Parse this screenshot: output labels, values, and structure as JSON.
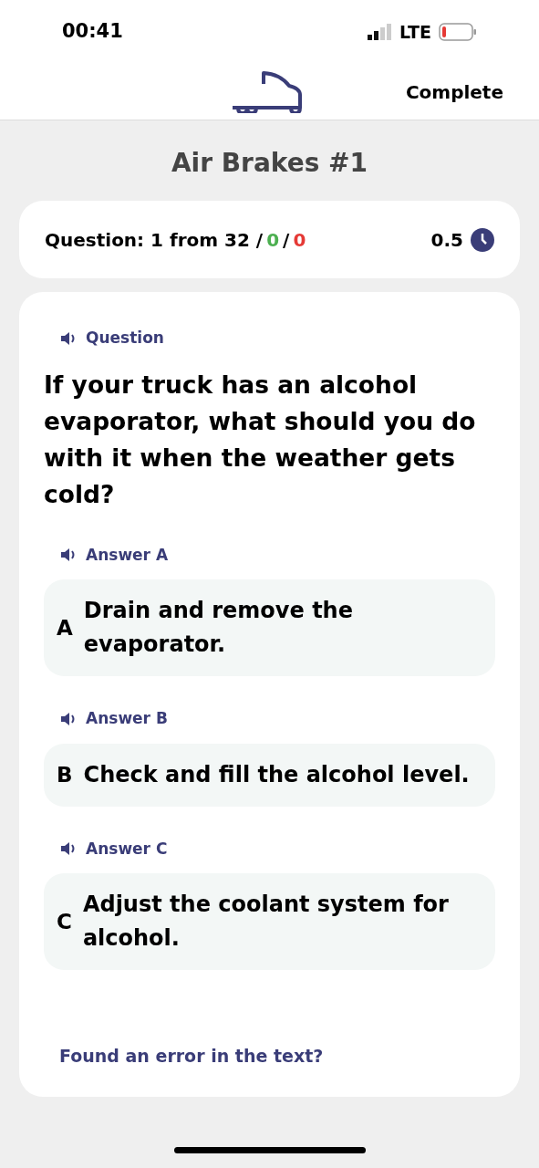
{
  "status_bar": {
    "time": "00:41",
    "network": "LTE"
  },
  "header": {
    "action": "Complete"
  },
  "title": "Air Brakes #1",
  "progress": {
    "parts": [
      {
        "text": "Question: 1 from 32 /",
        "color": "#000000"
      },
      {
        "text": "0",
        "color": "#4caf50"
      },
      {
        "text": "/",
        "color": "#000000"
      },
      {
        "text": "0",
        "color": "#e53935"
      }
    ],
    "time": "0.5"
  },
  "question": {
    "audio_label": "Question",
    "text": "If your truck has an alcohol evaporator, what should you do with it when the weather gets cold?"
  },
  "answers": [
    {
      "audio_label": "Answer A",
      "letter": "A",
      "text": "Drain and remove the evaporator."
    },
    {
      "audio_label": "Answer B",
      "letter": "B",
      "text": "Check and fill the alcohol level."
    },
    {
      "audio_label": "Answer C",
      "letter": "C",
      "text": "Adjust the coolant system for alcohol."
    }
  ],
  "report_link": "Found an error in the text?"
}
